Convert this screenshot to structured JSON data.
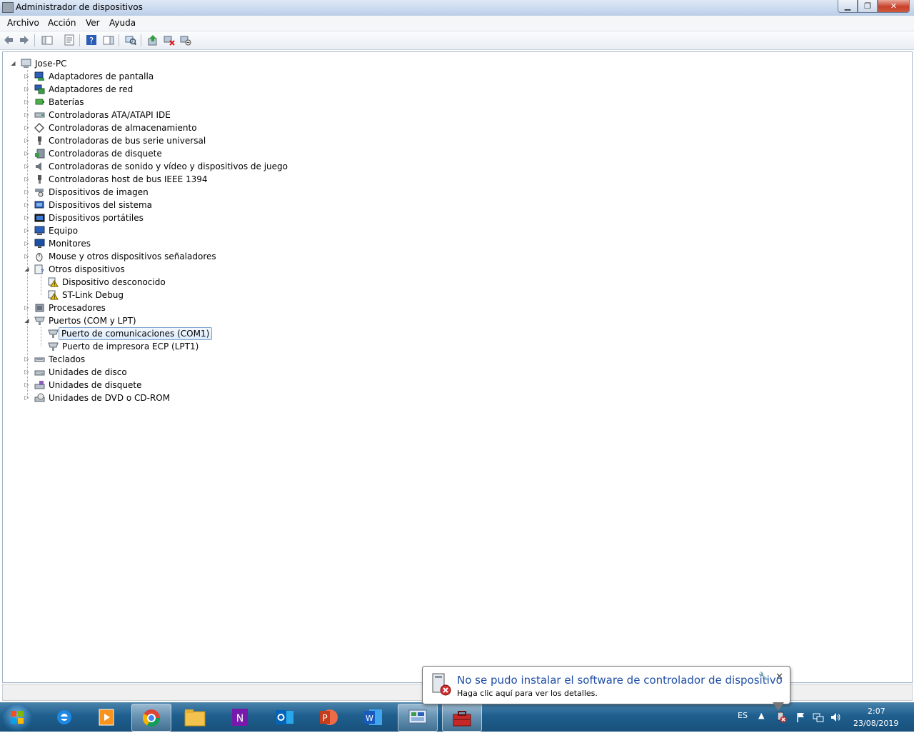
{
  "window": {
    "title": "Administrador de dispositivos"
  },
  "menu": [
    "Archivo",
    "Acción",
    "Ver",
    "Ayuda"
  ],
  "tree": {
    "root": "Jose-PC",
    "items": [
      {
        "label": "Adaptadores de pantalla",
        "icon": "display-adapter-icon"
      },
      {
        "label": "Adaptadores de red",
        "icon": "network-adapter-icon"
      },
      {
        "label": "Baterías",
        "icon": "battery-icon"
      },
      {
        "label": "Controladoras ATA/ATAPI IDE",
        "icon": "ide-controller-icon"
      },
      {
        "label": "Controladoras de almacenamiento",
        "icon": "storage-controller-icon"
      },
      {
        "label": "Controladoras de bus serie universal",
        "icon": "usb-icon"
      },
      {
        "label": "Controladoras de disquete",
        "icon": "floppy-controller-icon"
      },
      {
        "label": "Controladoras de sonido y vídeo y dispositivos de juego",
        "icon": "speaker-icon"
      },
      {
        "label": "Controladoras host de bus IEEE 1394",
        "icon": "firewire-icon"
      },
      {
        "label": "Dispositivos de imagen",
        "icon": "camera-icon"
      },
      {
        "label": "Dispositivos del sistema",
        "icon": "system-device-icon"
      },
      {
        "label": "Dispositivos portátiles",
        "icon": "portable-device-icon"
      },
      {
        "label": "Equipo",
        "icon": "computer-icon"
      },
      {
        "label": "Monitores",
        "icon": "monitor-icon"
      },
      {
        "label": "Mouse y otros dispositivos señaladores",
        "icon": "mouse-icon"
      },
      {
        "label": "Otros dispositivos",
        "icon": "unknown-device-icon",
        "expanded": true,
        "children": [
          {
            "label": "Dispositivo desconocido",
            "icon": "warning-device-icon"
          },
          {
            "label": "ST-Link Debug",
            "icon": "warning-device-icon"
          }
        ]
      },
      {
        "label": "Procesadores",
        "icon": "processor-icon"
      },
      {
        "label": "Puertos (COM y LPT)",
        "icon": "port-icon",
        "expanded": true,
        "children": [
          {
            "label": "Puerto de comunicaciones (COM1)",
            "icon": "port-icon",
            "selected": true
          },
          {
            "label": "Puerto de impresora ECP (LPT1)",
            "icon": "port-icon"
          }
        ]
      },
      {
        "label": "Teclados",
        "icon": "keyboard-icon"
      },
      {
        "label": "Unidades de disco",
        "icon": "disk-drive-icon"
      },
      {
        "label": "Unidades de disquete",
        "icon": "floppy-drive-icon"
      },
      {
        "label": "Unidades de DVD o CD-ROM",
        "icon": "dvd-drive-icon"
      }
    ]
  },
  "balloon": {
    "title": "No se pudo instalar el software de controlador de dispositivo",
    "text": "Haga clic aquí para ver los detalles."
  },
  "taskbar": {
    "apps": [
      "internet-explorer-icon",
      "media-player-icon",
      "chrome-icon",
      "file-explorer-icon",
      "onenote-icon",
      "outlook-icon",
      "powerpoint-icon",
      "word-icon",
      "control-panel-icon",
      "device-manager-icon"
    ],
    "language": "ES",
    "time": "2:07",
    "date": "23/08/2019"
  },
  "colors": {
    "selection_border": "#7da2ce",
    "balloon_title": "#1f4ea6",
    "taskbar": "#1f5f8e"
  }
}
